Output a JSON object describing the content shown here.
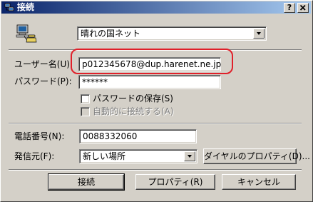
{
  "window": {
    "title": "接続",
    "help_btn": "?",
    "close_btn": "X"
  },
  "connection": {
    "selected": "晴れの国ネット"
  },
  "username": {
    "label": "ユーザー名(U):",
    "value": "p012345678@dup.harenet.ne.jp"
  },
  "password": {
    "label": "パスワード(P):",
    "value": "******"
  },
  "save_password": {
    "label": "パスワードの保存(S)",
    "checked": false
  },
  "auto_connect": {
    "label": "自動的に接続する(A)",
    "checked": false,
    "enabled": false
  },
  "phone": {
    "label": "電話番号(N):",
    "value": "0088332060"
  },
  "dial_from": {
    "label": "発信元(F):",
    "selected": "新しい場所",
    "properties_button": "ダイヤルのプロパティ(D)..."
  },
  "buttons": {
    "connect": "接続",
    "properties": "プロパティ(R)",
    "cancel": "キャンセル"
  },
  "colors": {
    "titlebar_start": "#0a246a",
    "titlebar_end": "#a6caf0",
    "highlight": "#e0202a",
    "face": "#d4d0c8"
  }
}
